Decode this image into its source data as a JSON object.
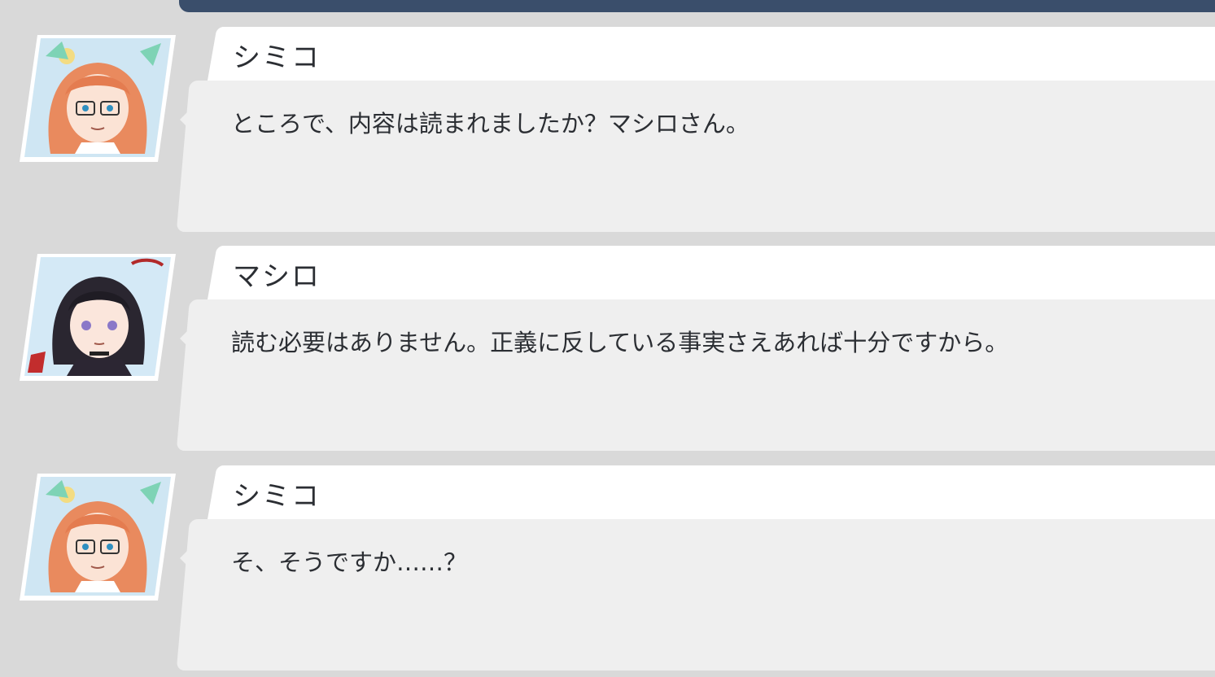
{
  "messages": [
    {
      "speaker": "シミコ",
      "avatar_icon": "shimiko-portrait-icon",
      "text": "ところで、内容は読まれましたか？マシロさん。"
    },
    {
      "speaker": "マシロ",
      "avatar_icon": "mashiro-portrait-icon",
      "text": "読む必要はありません。正義に反している事実さえあれば十分ですから。"
    },
    {
      "speaker": "シミコ",
      "avatar_icon": "shimiko-portrait-icon",
      "text": "そ、そうですか……？"
    }
  ],
  "colors": {
    "background": "#d9d9d9",
    "header_bar": "#3a4e6b",
    "name_tab": "#ffffff",
    "bubble": "#efefef",
    "text": "#2b2e33"
  }
}
